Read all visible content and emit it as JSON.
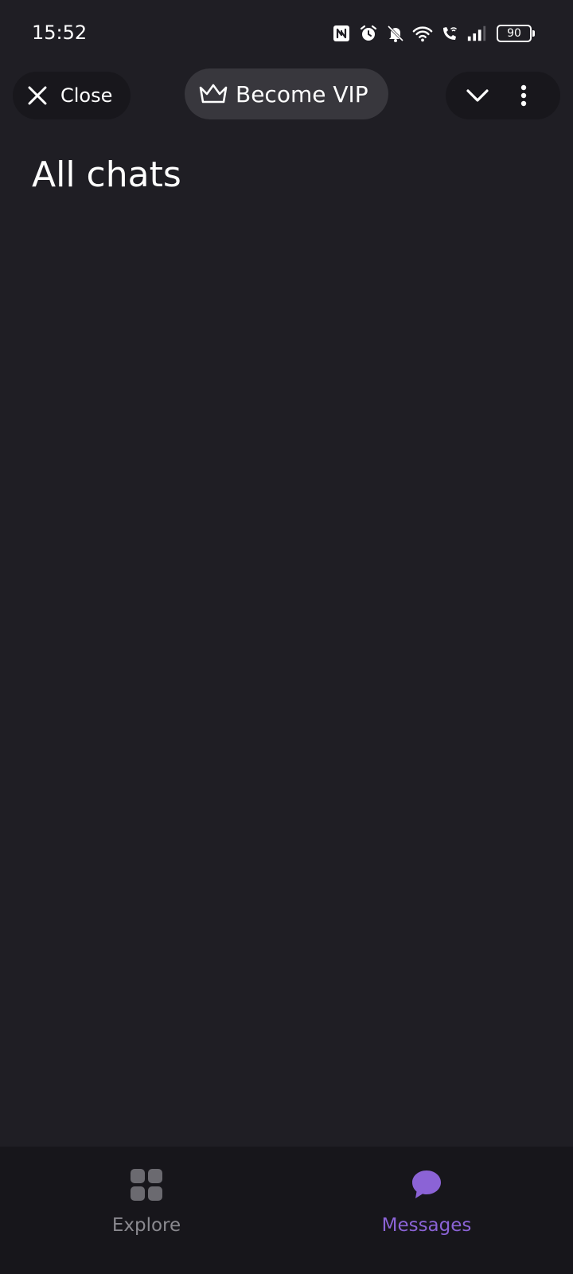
{
  "status_bar": {
    "time": "15:52",
    "battery": "90",
    "icons": [
      "nfc-icon",
      "alarm-icon",
      "bell-muted-icon",
      "wifi-icon",
      "wifi-call-icon",
      "signal-icon"
    ]
  },
  "toolbar": {
    "close_label": "Close",
    "vip_label": "Become VIP"
  },
  "page": {
    "title": "All chats"
  },
  "bottom_nav": {
    "items": [
      {
        "label": "Explore",
        "icon": "grid-icon",
        "active": false
      },
      {
        "label": "Messages",
        "icon": "chat-bubble-icon",
        "active": true
      }
    ]
  },
  "colors": {
    "background": "#1f1e24",
    "accent": "#8b63d6",
    "inactive": "#8a898f"
  }
}
